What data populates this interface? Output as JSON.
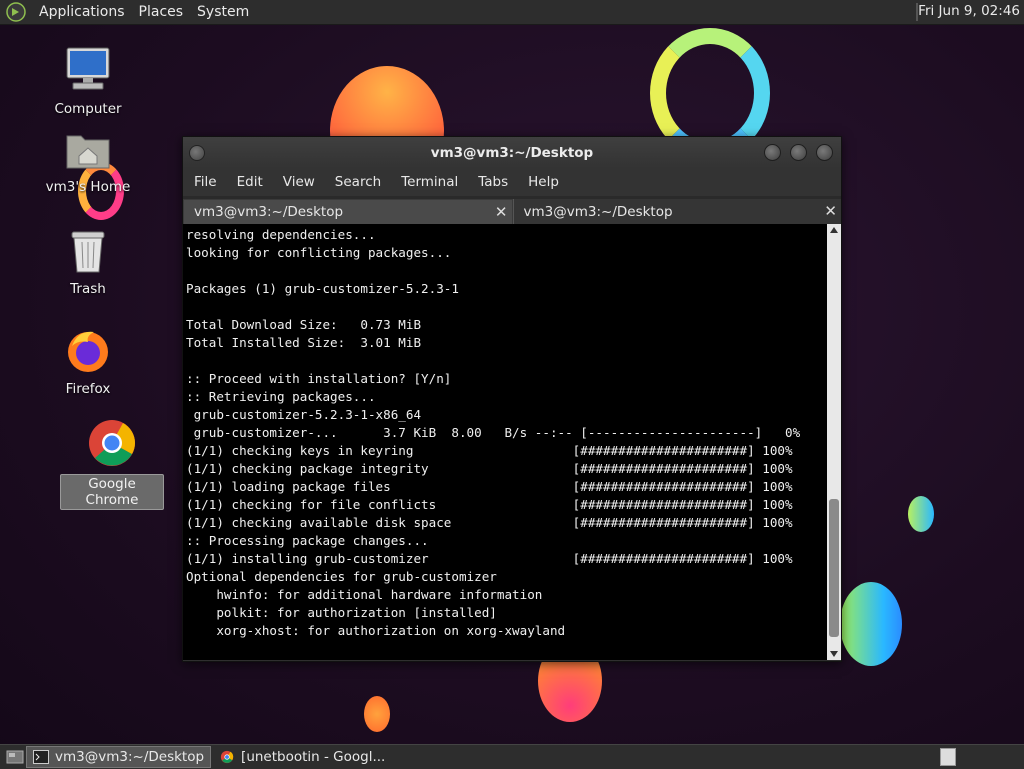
{
  "top_panel": {
    "menus": [
      "Applications",
      "Places",
      "System"
    ],
    "clock": "Fri Jun  9, 02:46"
  },
  "desktop_icons": [
    {
      "label": "Computer"
    },
    {
      "label": "vm3's Home"
    },
    {
      "label": "Trash"
    },
    {
      "label": "Firefox"
    },
    {
      "label": "Google Chrome",
      "selected": true
    }
  ],
  "window": {
    "title": "vm3@vm3:~/Desktop",
    "menu": [
      "File",
      "Edit",
      "View",
      "Search",
      "Terminal",
      "Tabs",
      "Help"
    ],
    "tabs": [
      {
        "label": "vm3@vm3:~/Desktop",
        "active": false
      },
      {
        "label": "vm3@vm3:~/Desktop",
        "active": true
      }
    ],
    "terminal_lines": [
      "resolving dependencies...",
      "looking for conflicting packages...",
      "",
      "Packages (1) grub-customizer-5.2.3-1",
      "",
      "Total Download Size:   0.73 MiB",
      "Total Installed Size:  3.01 MiB",
      "",
      ":: Proceed with installation? [Y/n]",
      ":: Retrieving packages...",
      " grub-customizer-5.2.3-1-x86_64",
      " grub-customizer-...      3.7 KiB  8.00   B/s --:-- [----------------------]   0%",
      "(1/1) checking keys in keyring                     [######################] 100%",
      "(1/1) checking package integrity                   [######################] 100%",
      "(1/1) loading package files                        [######################] 100%",
      "(1/1) checking for file conflicts                  [######################] 100%",
      "(1/1) checking available disk space                [######################] 100%",
      ":: Processing package changes...",
      "(1/1) installing grub-customizer                   [######################] 100%",
      "Optional dependencies for grub-customizer",
      "    hwinfo: for additional hardware information",
      "    polkit: for authorization [installed]",
      "    xorg-xhost: for authorization on xorg-xwayland"
    ]
  },
  "taskbar": {
    "tasks": [
      {
        "label": "vm3@vm3:~/Desktop",
        "active": true
      },
      {
        "label": "[unetbootin - Googl...",
        "active": false
      }
    ]
  }
}
